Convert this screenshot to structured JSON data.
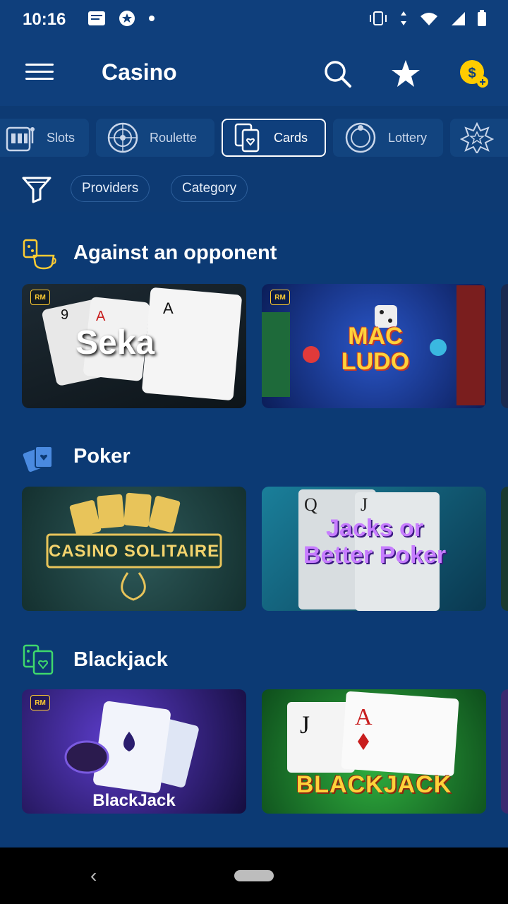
{
  "status": {
    "time": "10:16"
  },
  "appbar": {
    "title": "Casino"
  },
  "categories": [
    {
      "label": "Slots",
      "icon": "slot-machine-icon"
    },
    {
      "label": "Roulette",
      "icon": "roulette-icon"
    },
    {
      "label": "Cards",
      "icon": "cards-icon",
      "active": true
    },
    {
      "label": "Lottery",
      "icon": "lottery-icon"
    },
    {
      "label": "",
      "icon": "star-badge-icon"
    }
  ],
  "filters": {
    "providers": "Providers",
    "category": "Category"
  },
  "sections": [
    {
      "title": "Against an opponent",
      "games": [
        {
          "label": "Seka",
          "badge": "RM"
        },
        {
          "label": "MAC LUDO",
          "badge": "RM"
        }
      ]
    },
    {
      "title": "Poker",
      "games": [
        {
          "label": "CASINO SOLITAIRE",
          "badge": ""
        },
        {
          "label": "Jacks or Better Poker",
          "badge": ""
        }
      ]
    },
    {
      "title": "Blackjack",
      "games": [
        {
          "label": "BlackJack",
          "badge": "RM"
        },
        {
          "label": "BLACKJACK",
          "badge": ""
        }
      ]
    }
  ],
  "colors": {
    "background": "#0d3a73",
    "accent": "#ffcc33",
    "chip_border": "#2c5e9a"
  }
}
